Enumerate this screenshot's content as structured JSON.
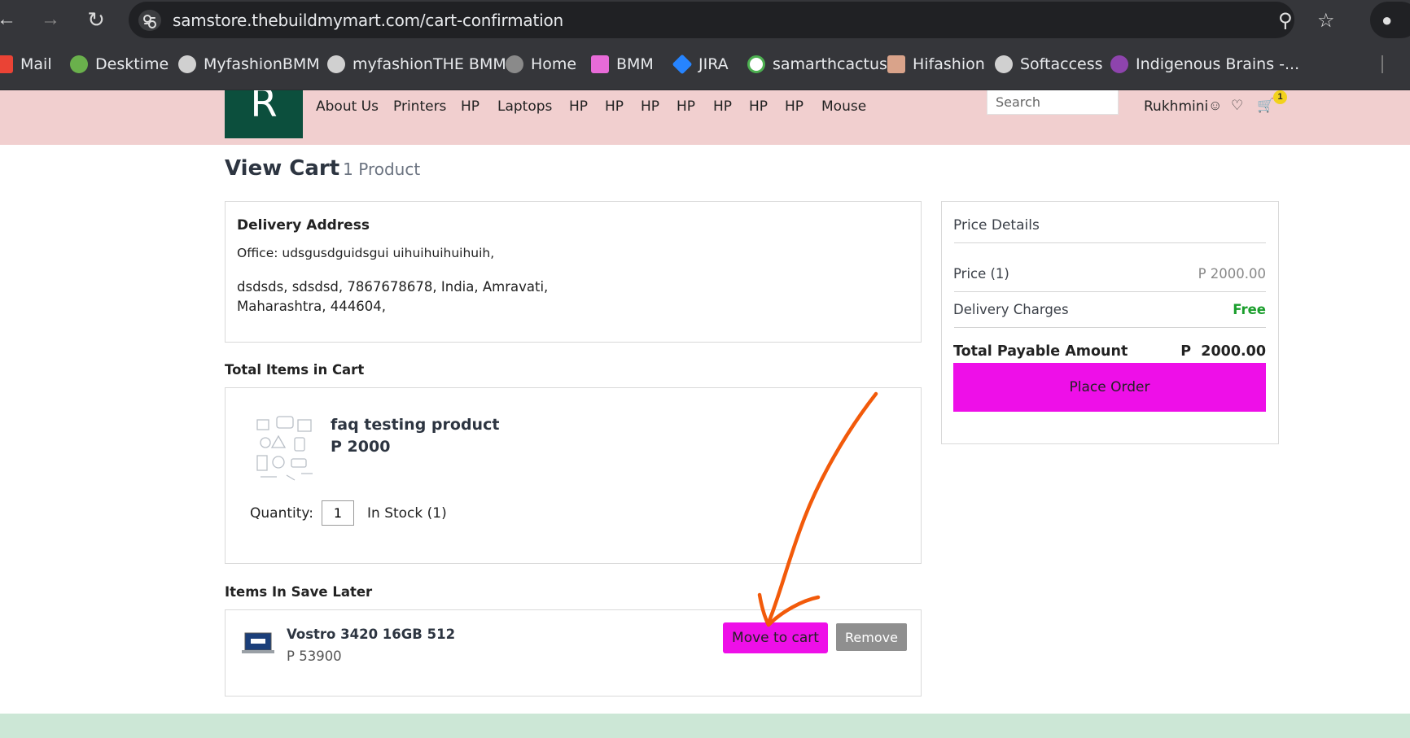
{
  "browser": {
    "url": "samstore.thebuildmymart.com/cart-confirmation",
    "back_icon": "back-arrow-icon",
    "forward_icon": "forward-arrow-icon",
    "reload_icon": "reload-icon",
    "bookmarks": [
      {
        "label": "Mail",
        "icon": "gmail-icon",
        "color": "#ea4335"
      },
      {
        "label": "Desktime",
        "icon": "desktime-icon",
        "color": "#6ab04c"
      },
      {
        "label": "MyfashionBMM",
        "icon": "globe-icon",
        "color": "#d0d0d0"
      },
      {
        "label": "myfashionTHE BMM",
        "icon": "globe-icon",
        "color": "#d0d0d0"
      },
      {
        "label": "Home",
        "icon": "globe-icon",
        "color": "#8a8a8a"
      },
      {
        "label": "BMM",
        "icon": "bmm-icon",
        "color": "#e86bd8"
      },
      {
        "label": "JIRA",
        "icon": "jira-icon",
        "color": "#2684ff"
      },
      {
        "label": "samarthcactus",
        "icon": "cactus-icon",
        "color": "#4caf50"
      },
      {
        "label": "Hifashion",
        "icon": "hifashion-icon",
        "color": "#d9a38a"
      },
      {
        "label": "Softaccess",
        "icon": "globe-icon",
        "color": "#d0d0d0"
      },
      {
        "label": "Indigenous Brains -...",
        "icon": "indigenous-icon",
        "color": "#8e44ad"
      }
    ]
  },
  "header": {
    "logo_letter": "R",
    "nav": [
      "About Us",
      "Printers",
      "HP",
      "Laptops",
      "HP",
      "HP",
      "HP",
      "HP",
      "HP",
      "HP",
      "HP",
      "Mouse"
    ],
    "search_placeholder": "Search",
    "user_name": "Rukhmini",
    "cart_count": "1"
  },
  "page": {
    "title": "View Cart",
    "product_count": "1 Product"
  },
  "delivery": {
    "heading": "Delivery Address",
    "line1": "Office: udsgusdguidsgui uihuihuihuihuih,",
    "line2": "dsdsds, sdsdsd, 7867678678, India, Amravati,",
    "line3": "Maharashtra, 444604,"
  },
  "cart": {
    "heading": "Total Items in Cart",
    "item": {
      "name": "faq testing product",
      "price": "P 2000",
      "quantity_label": "Quantity:",
      "quantity": "1",
      "stock": "In Stock (1)"
    }
  },
  "save_later": {
    "heading": "Items In Save Later",
    "item": {
      "name": "Vostro 3420 16GB 512",
      "price": "P 53900",
      "move_label": "Move to cart",
      "remove_label": "Remove"
    }
  },
  "price_details": {
    "heading": "Price Details",
    "price_label": "Price  (1)",
    "price_value": "P 2000.00",
    "delivery_label": "Delivery Charges",
    "delivery_value": "Free",
    "total_label": "Total Payable Amount",
    "total_value": "P  2000.00",
    "place_order_label": "Place Order"
  },
  "colors": {
    "accent": "#ee0fe8",
    "header_bg": "#f1cfcf",
    "logo_bg": "#0c4f3d",
    "free_green": "#1a9e2c",
    "annotation_arrow": "#f25a0a",
    "footer_bg": "#cce7d6"
  }
}
